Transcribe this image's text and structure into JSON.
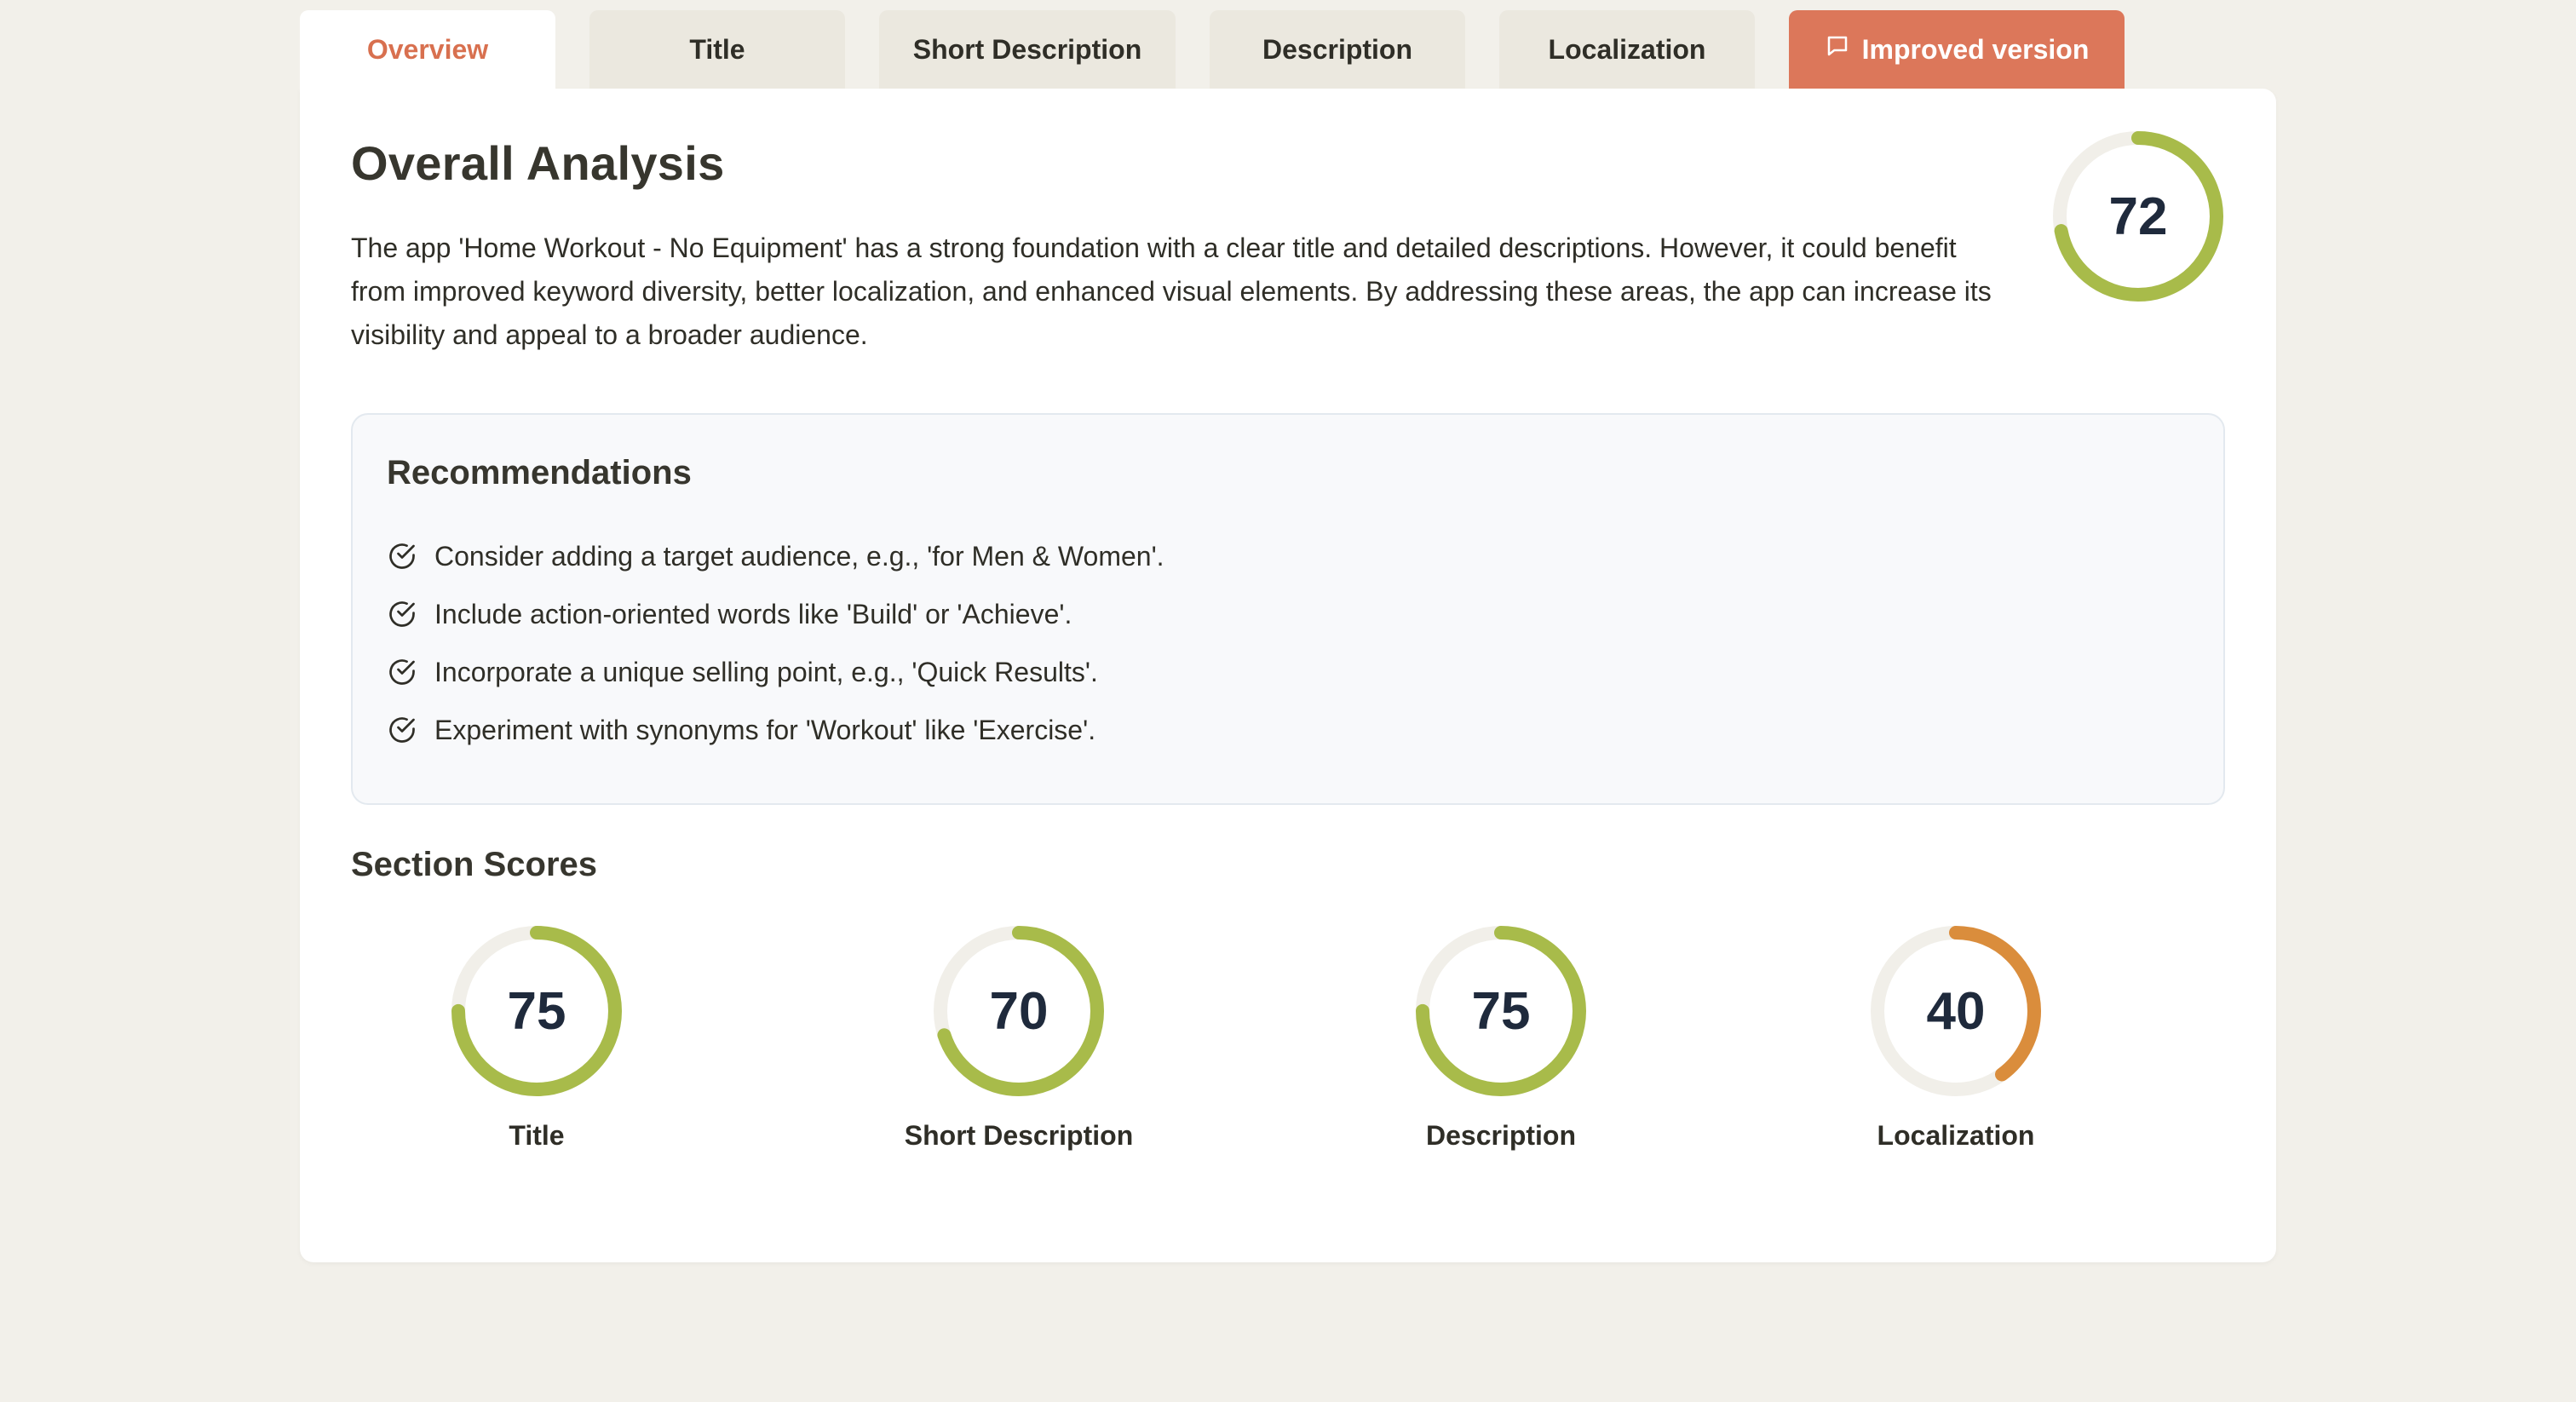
{
  "tabs": [
    {
      "label": "Overview",
      "active": true
    },
    {
      "label": "Title"
    },
    {
      "label": "Short Description"
    },
    {
      "label": "Description"
    },
    {
      "label": "Localization"
    }
  ],
  "improved_button": {
    "label": "Improved version",
    "icon": "chat-bubble-icon"
  },
  "overview": {
    "title": "Overall Analysis",
    "summary": "The app 'Home Workout - No Equipment' has a strong foundation with a clear title and detailed descriptions. However, it could benefit from improved keyword diversity, better localization, and enhanced visual elements. By addressing these areas, the app can increase its visibility and appeal to a broader audience.",
    "score": 72
  },
  "recommendations": {
    "title": "Recommendations",
    "items": [
      "Consider adding a target audience, e.g., 'for Men & Women'.",
      "Include action-oriented words like 'Build' or 'Achieve'.",
      "Incorporate a unique selling point, e.g., 'Quick Results'.",
      "Experiment with synonyms for 'Workout' like 'Exercise'."
    ]
  },
  "section_scores": {
    "title": "Section Scores",
    "items": [
      {
        "label": "Title",
        "score": 75,
        "color": "#a8bb4a"
      },
      {
        "label": "Short Description",
        "score": 70,
        "color": "#a8bb4a"
      },
      {
        "label": "Description",
        "score": 75,
        "color": "#a8bb4a"
      },
      {
        "label": "Localization",
        "score": 40,
        "color": "#da8d3c"
      }
    ]
  },
  "colors": {
    "accent": "#dc775a",
    "ring_track": "#f1efe9",
    "good": "#a8bb4a",
    "warning": "#da8d3c",
    "background": "#f2f0ea"
  }
}
